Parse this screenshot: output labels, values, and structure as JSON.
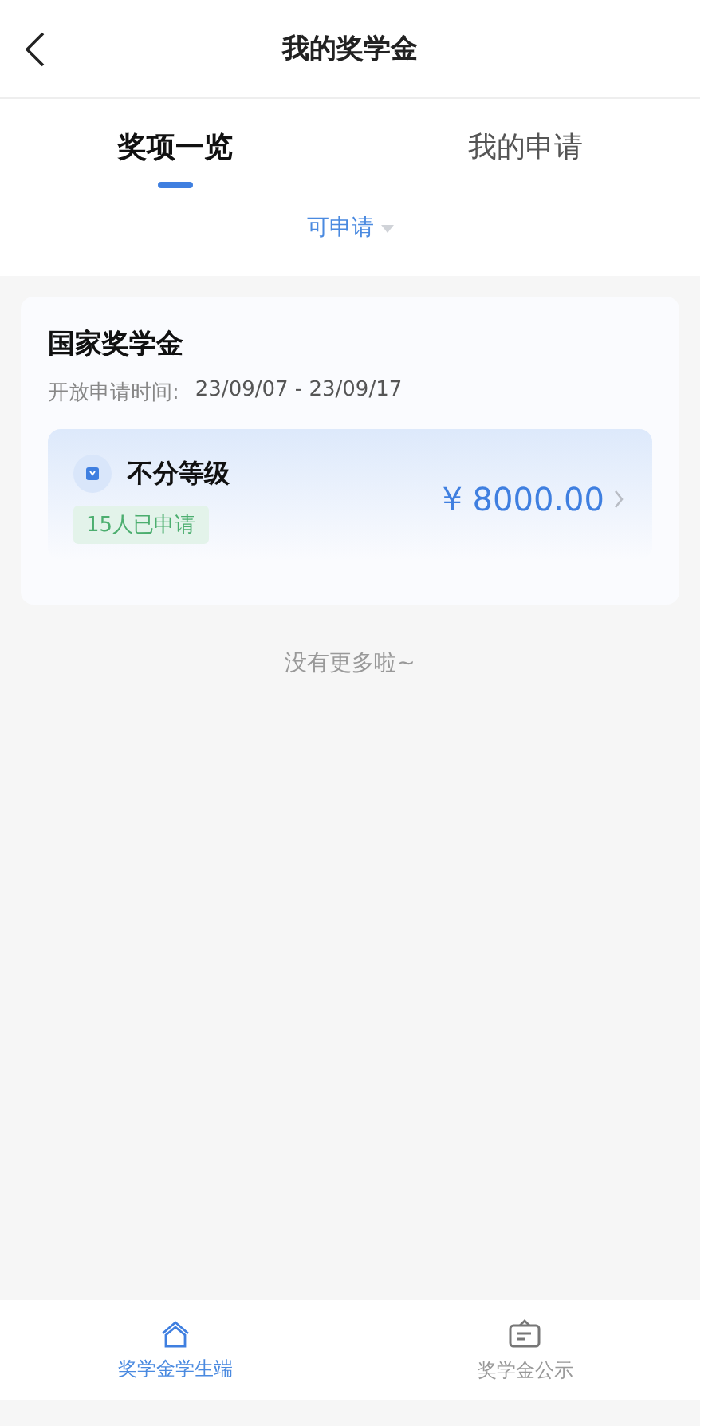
{
  "header": {
    "title": "我的奖学金"
  },
  "tabs": [
    {
      "label": "奖项一览",
      "selected": true
    },
    {
      "label": "我的申请",
      "selected": false
    }
  ],
  "filter": {
    "label": "可申请"
  },
  "scholarships": [
    {
      "name": "国家奖学金",
      "period_label": "开放申请时间:",
      "period": "23/09/07 - 23/09/17",
      "levels": [
        {
          "name": "不分等级",
          "applicants": "15人已申请",
          "amount": "¥ 8000.00"
        }
      ]
    }
  ],
  "end_note": "没有更多啦~",
  "bottom_nav": [
    {
      "label": "奖学金学生端",
      "kind": "home",
      "selected": true
    },
    {
      "label": "奖学金公示",
      "kind": "board",
      "selected": false
    }
  ]
}
